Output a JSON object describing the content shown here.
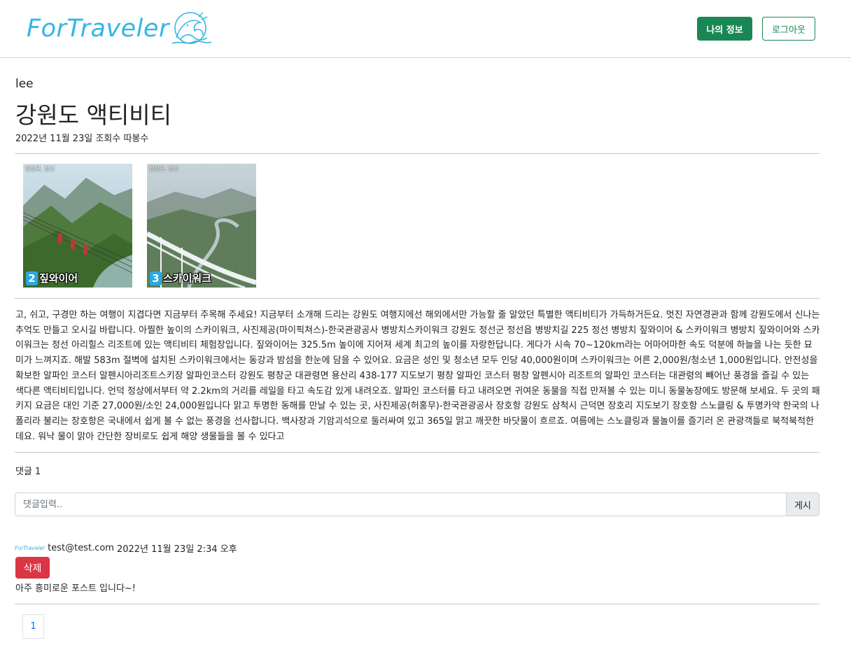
{
  "header": {
    "logo_text": "ForTraveler",
    "my_info_label": "나의 정보",
    "logout_label": "로그아웃"
  },
  "post": {
    "author": "lee",
    "title": "강원도 액티비티",
    "meta": "2022년 11월 23일 조회수 따봉수",
    "photos": [
      {
        "number": "2",
        "caption": "짚와이어",
        "tag": "평창군, 정선"
      },
      {
        "number": "3",
        "caption": "스카이워크",
        "tag": "평창군, 정선"
      }
    ],
    "body": "고, 쉬고, 구경만 하는 여행이 지겹다면 지금부터 주목해 주세요! 지금부터 소개해 드리는 강원도 여행지에선 해외에서만 가능할 줄 알았던 특별한 액티비티가 가득하거든요. 멋진 자연경관과 함께 강원도에서 신나는 추억도 만들고 오시길 바랍니다. 아찔한 높이의 스카이워크, 사진제공(마이픽쳐스)-한국관광공사 병방치스카이워크 강원도 정선군 정선읍 병방치길 225 정선 병방치 짚와이어 & 스카이워크 병방치 짚와이어와 스카이워크는 정선 아리힐스 리조트에 있는 액티비티 체험장입니다. 짚와이어는 325.5m 높이에 지어져 세계 최고의 높이를 자랑한답니다. 게다가 시속 70~120km라는 어마어마한 속도 덕분에 하늘을 나는 듯한 묘미가 느껴지죠. 해발 583m 절벽에 설치된 스카이워크에서는 동강과 밤섬을 한눈에 담을 수 있어요. 요금은 성인 및 청소년 모두 인당 40,000원이며 스카이워크는 어른 2,000원/청소년 1,000원입니다. 안전성을 확보한 알파인 코스터 알펜시아리조트스키장 알파인코스터 강원도 평창군 대관령면 용산리 438-177 지도보기 평창 알파인 코스터 평창 알펜시아 리조트의 알파인 코스터는 대관령의 빼어난 풍경을 즐길 수 있는 색다른 액티비티입니다. 언덕 정상에서부터 약 2.2km의 거리를 레일을 타고 속도감 있게 내려오죠. 알파인 코스터를 타고 내려오면 귀여운 동물을 직접 만져볼 수 있는 미니 동물농장에도 방문해 보세요. 두 곳의 패키지 요금은 대인 기준 27,000원/소인 24,000원입니다 맑고 투명한 동해를 만날 수 있는 곳, 사진제공(허홍무)-한국관광공사 장호항 강원도 삼척시 근덕면 장호리 지도보기 장호항 스노클링 & 투명카약 한국의 나폴리라 불리는 장호항은 국내에서 쉽게 볼 수 없는 풍경을 선사합니다. 백사장과 기암괴석으로 둘러싸여 있고 365일 맑고 깨끗한 바닷물이 흐르죠. 여름에는 스노클링과 물놀이를 즐기러 온 관광객들로 북적북적한데요. 워낙 물이 맑아 간단한 장비로도 쉽게 해양 생물들을 볼 수 있다고"
  },
  "comments": {
    "count_label": "댓글 1",
    "input_placeholder": "댓글입력..",
    "post_button": "게시",
    "items": [
      {
        "avatar_text": "ForTraveler",
        "user": "test@test.com",
        "date": "2022년 11월 23일 2:34 오후",
        "delete_label": "삭제",
        "text": "아주 흥미로운 포스트 입니다~!"
      }
    ]
  },
  "pagination": {
    "current": "1"
  },
  "colors": {
    "brand": "#33b6e6",
    "success": "#198754",
    "danger": "#dc3545",
    "link": "#0d6efd"
  }
}
